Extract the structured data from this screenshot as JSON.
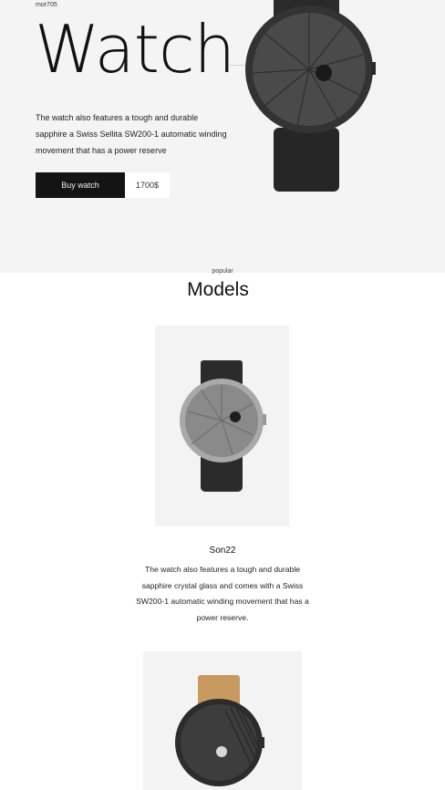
{
  "hero": {
    "model_tag": "mor705",
    "title": "Watch",
    "description": "The watch also features a tough and durable sapphire a Swiss Sellita SW200-1 automatic winding movement that has a power reserve",
    "buy_label": "Buy watch",
    "price": "1700$"
  },
  "models": {
    "eyebrow": "popular",
    "title": "Models",
    "items": [
      {
        "name": "Son22",
        "description": "The watch also features a tough and durable sapphire crystal glass and comes with a Swiss SW200-1 automatic winding movement that has a power reserve."
      }
    ]
  },
  "colors": {
    "hero_bg": "#f4f4f4",
    "button_bg": "#141414",
    "card_bg": "#f3f3f3",
    "strap_tan": "#c99a60"
  },
  "icons": [
    "dark-watch-image",
    "silver-watch-image",
    "tan-strap-watch-image"
  ]
}
